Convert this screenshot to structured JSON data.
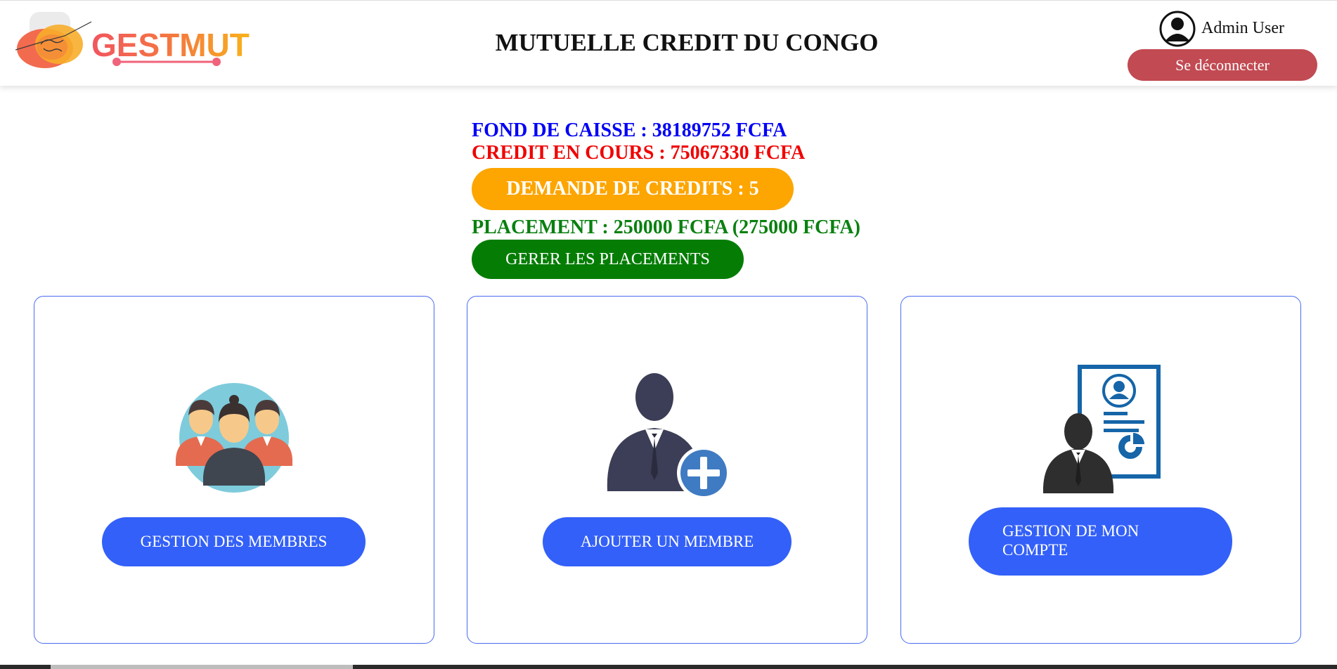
{
  "header": {
    "logo_text": "GESTMUT",
    "title": "MUTUELLE CREDIT DU CONGO",
    "user_name": "Admin User",
    "logout_label": "Se déconnecter"
  },
  "stats": {
    "fond_de_caisse": "FOND DE CAISSE : 38189752 FCFA",
    "credit_en_cours": "CREDIT EN COURS : 75067330 FCFA",
    "demande_credits": "DEMANDE DE CREDITS : 5",
    "placement": "PLACEMENT : 250000 FCFA (275000 FCFA)",
    "gerer_placements": "GERER LES PLACEMENTS"
  },
  "cards": [
    {
      "icon": "members-group-icon",
      "label": "GESTION DES MEMBRES"
    },
    {
      "icon": "add-member-icon",
      "label": "AJOUTER UN MEMBRE"
    },
    {
      "icon": "account-document-icon",
      "label": "GESTION DE MON COMPTE"
    }
  ],
  "colors": {
    "fond": "#0000f5",
    "credit": "#f00000",
    "demande": "#fda500",
    "placement": "#0a8010",
    "card_button": "#3360f8",
    "logout": "#c24a52"
  }
}
